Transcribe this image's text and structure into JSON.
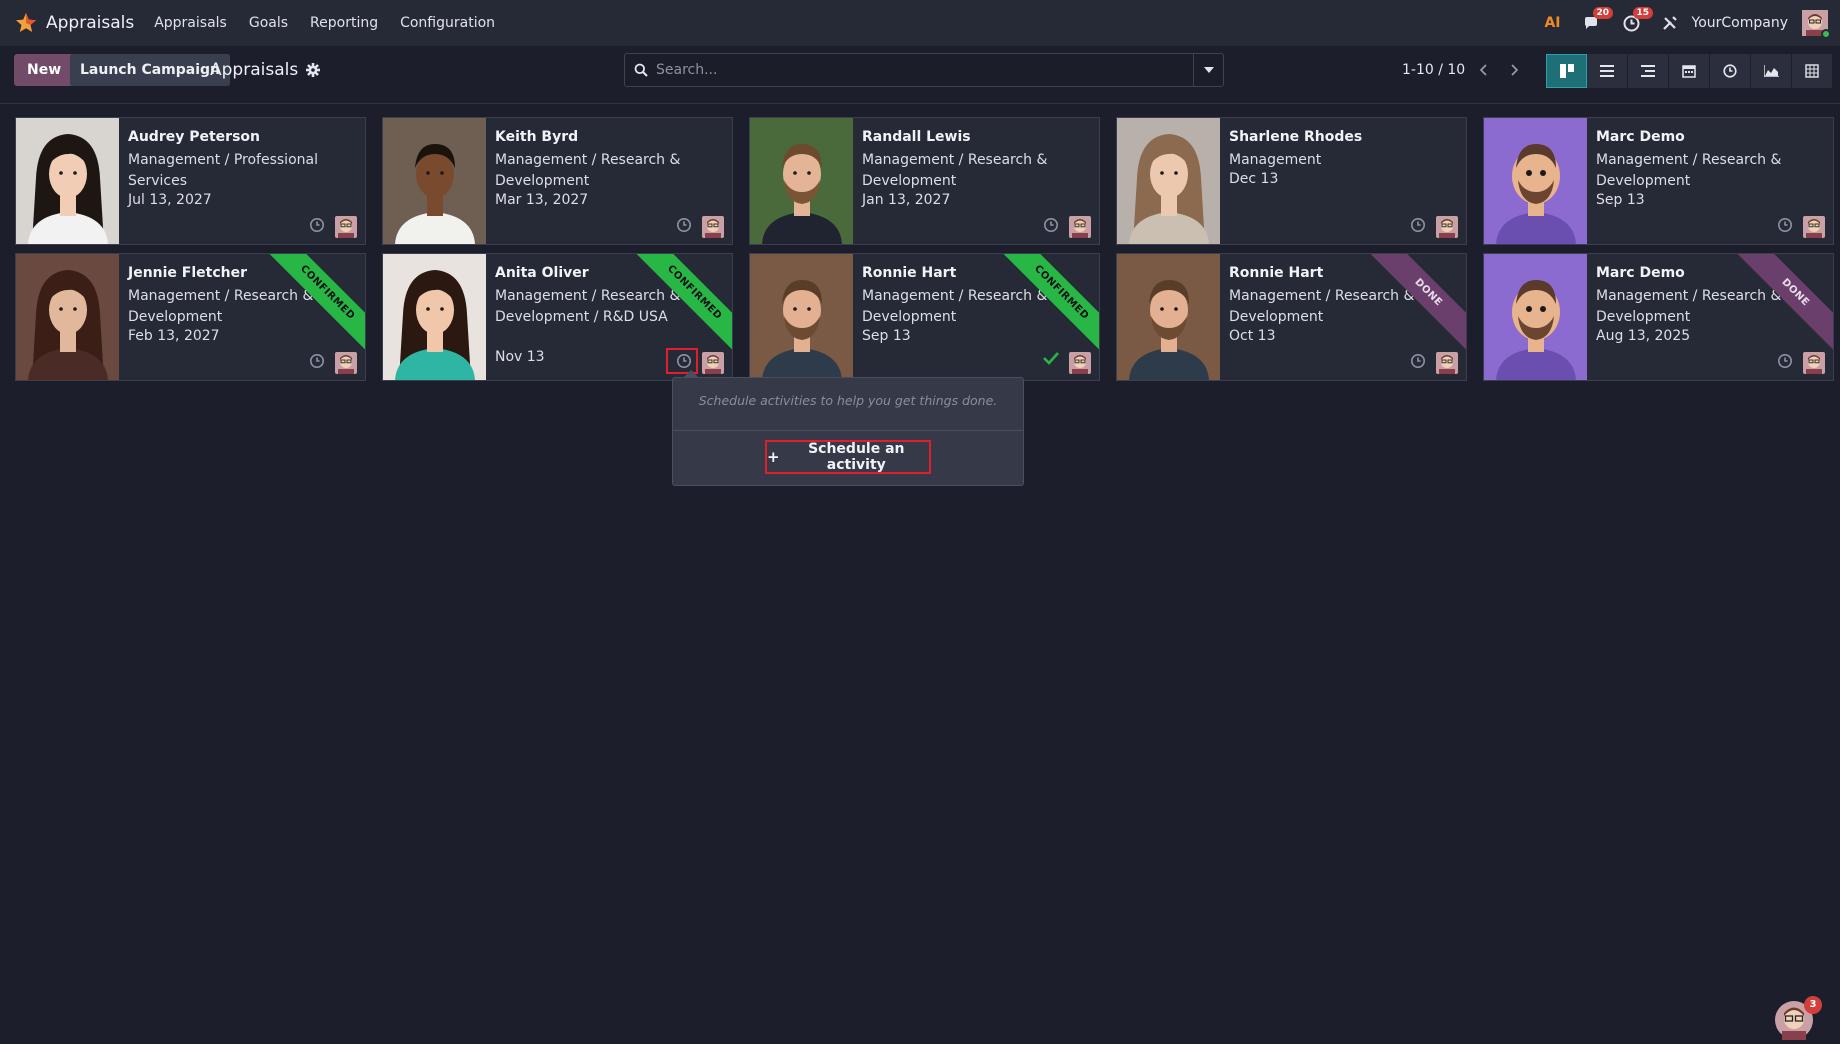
{
  "navbar": {
    "app_name": "Appraisals",
    "menu": [
      "Appraisals",
      "Goals",
      "Reporting",
      "Configuration"
    ],
    "ai_label": "AI",
    "messages_count": "20",
    "activities_count": "15",
    "company": "YourCompany"
  },
  "control": {
    "new_label": "New",
    "launch_label": "Launch Campaign",
    "breadcrumb": "Appraisals",
    "search_placeholder": "Search...",
    "pager": "1-10 / 10",
    "views": [
      "kanban",
      "list",
      "hierarchy",
      "calendar",
      "activity",
      "graph",
      "pivot"
    ],
    "active_view": "kanban"
  },
  "cards": [
    {
      "name": "Audrey Peterson",
      "dept": "Management / Professional Services",
      "date": "Jul 13, 2027",
      "ribbon": "",
      "photo": "woman-asian"
    },
    {
      "name": "Keith Byrd",
      "dept": "Management / Research & Development",
      "date": "Mar 13, 2027",
      "ribbon": "",
      "photo": "man-dark"
    },
    {
      "name": "Randall Lewis",
      "dept": "Management / Research & Development",
      "date": "Jan 13, 2027",
      "ribbon": "",
      "photo": "man-suit"
    },
    {
      "name": "Sharlene Rhodes",
      "dept": "Management",
      "date": "Dec 13",
      "ribbon": "",
      "photo": "woman-curly"
    },
    {
      "name": "Marc Demo",
      "dept": "Management / Research & Development",
      "date": "Sep 13",
      "ribbon": "",
      "photo": "cartoon-man"
    },
    {
      "name": "Jennie Fletcher",
      "dept": "Management / Research & Development",
      "date": "Feb 13, 2027",
      "ribbon": "CONFIRMED",
      "photo": "woman-brunette"
    },
    {
      "name": "Anita Oliver",
      "dept": "Management / Research & Development / R&D USA",
      "date": "Nov 13",
      "ribbon": "CONFIRMED",
      "photo": "woman-smile"
    },
    {
      "name": "Ronnie Hart",
      "dept": "Management / Research & Development",
      "date": "Sep 13",
      "ribbon": "CONFIRMED",
      "photo": "man-beard"
    },
    {
      "name": "Ronnie Hart",
      "dept": "Management / Research & Development",
      "date": "Oct 13",
      "ribbon": "DONE",
      "photo": "man-beard"
    },
    {
      "name": "Marc Demo",
      "dept": "Management / Research & Development",
      "date": "Aug 13, 2025",
      "ribbon": "DONE",
      "photo": "cartoon-man"
    }
  ],
  "popover": {
    "hint": "Schedule activities to help you get things done.",
    "button_label": "Schedule an activity"
  },
  "chat": {
    "badge": "3"
  },
  "colors": {
    "accent": "#714b67",
    "confirmed": "#28b745",
    "done": "#6a3f6c",
    "highlight": "#e01e2c",
    "background": "#1c1e2b"
  }
}
